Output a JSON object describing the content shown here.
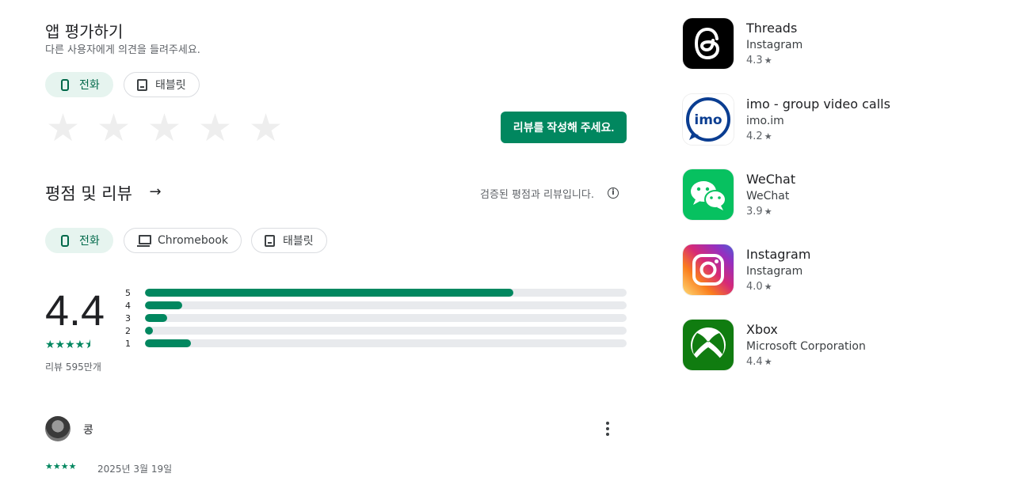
{
  "rate": {
    "title": "앱 평가하기",
    "subtitle": "다른 사용자에게 의견을 들려주세요.",
    "chips": [
      {
        "label": "전화",
        "icon": "phone-icon"
      },
      {
        "label": "태블릿",
        "icon": "tablet-icon"
      }
    ],
    "empty_star": "★",
    "write_button": "리뷰를 작성해 주세요."
  },
  "reviews": {
    "title": "평점 및 리뷰",
    "arrow": "→",
    "verified": "검증된 평점과 리뷰입니다.",
    "info": "i",
    "chips": [
      {
        "label": "전화",
        "icon": "phone-icon"
      },
      {
        "label": "Chromebook",
        "icon": "laptop-icon"
      },
      {
        "label": "태블릿",
        "icon": "tablet-icon"
      }
    ],
    "average": "4.4",
    "stars": "★★★★⯨",
    "count": "리뷰 595만개",
    "distribution": [
      {
        "label": "5",
        "fraction": 0.765
      },
      {
        "label": "4",
        "fraction": 0.078
      },
      {
        "label": "3",
        "fraction": 0.046
      },
      {
        "label": "2",
        "fraction": 0.016
      },
      {
        "label": "1",
        "fraction": 0.095
      }
    ],
    "first_review": {
      "author": "콩",
      "stars": "★★★★",
      "date": "2025년 3월 19일"
    }
  },
  "similar_apps": [
    {
      "name": "Threads",
      "developer": "Instagram",
      "rating": "4.3",
      "icon": "threads-icon"
    },
    {
      "name": "imo - group video calls",
      "developer": "imo.im",
      "rating": "4.2",
      "icon": "imo-icon"
    },
    {
      "name": "WeChat",
      "developer": "WeChat",
      "rating": "3.9",
      "icon": "wechat-icon"
    },
    {
      "name": "Instagram",
      "developer": "Instagram",
      "rating": "4.0",
      "icon": "instagram-icon"
    },
    {
      "name": "Xbox",
      "developer": "Microsoft Corporation",
      "rating": "4.4",
      "icon": "xbox-icon"
    }
  ],
  "colors": {
    "accent": "#01875f",
    "selected_chip_bg": "#e6f4ef",
    "bar_track": "#e8eaed"
  }
}
